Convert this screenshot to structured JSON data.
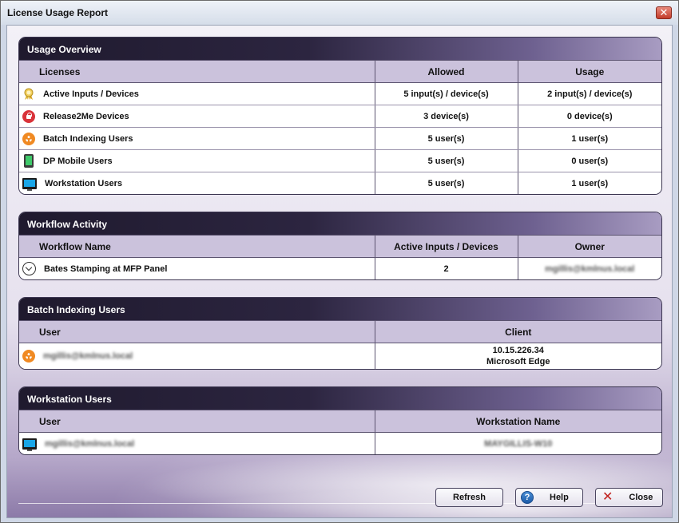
{
  "window": {
    "title": "License Usage Report",
    "close_glyph": "✕"
  },
  "usage_overview": {
    "title": "Usage Overview",
    "headers": [
      "Licenses",
      "Allowed",
      "Usage"
    ],
    "rows": [
      {
        "icon": "ribbon-icon",
        "name": "Active Inputs / Devices",
        "allowed": "5 input(s) / device(s)",
        "usage": "2 input(s) / device(s)"
      },
      {
        "icon": "lock-icon",
        "name": "Release2Me Devices",
        "allowed": "3 device(s)",
        "usage": "0 device(s)"
      },
      {
        "icon": "batch-indexing-icon",
        "name": "Batch Indexing Users",
        "allowed": "5 user(s)",
        "usage": "1 user(s)"
      },
      {
        "icon": "mobile-phone-icon",
        "name": "DP Mobile Users",
        "allowed": "5 user(s)",
        "usage": "0 user(s)"
      },
      {
        "icon": "monitor-icon",
        "name": "Workstation Users",
        "allowed": "5 user(s)",
        "usage": "1 user(s)"
      }
    ]
  },
  "workflow_activity": {
    "title": "Workflow Activity",
    "headers": [
      "Workflow Name",
      "Active Inputs / Devices",
      "Owner"
    ],
    "rows": [
      {
        "name": "Bates Stamping at MFP Panel",
        "active": "2",
        "owner": "mgillis@kmlnus.local"
      }
    ]
  },
  "batch_indexing_users": {
    "title": "Batch Indexing Users",
    "headers": [
      "User",
      "Client"
    ],
    "rows": [
      {
        "user": "mgillis@kmlnus.local",
        "client_ip": "10.15.226.34",
        "client_browser": "Microsoft Edge"
      }
    ]
  },
  "workstation_users": {
    "title": "Workstation Users",
    "headers": [
      "User",
      "Workstation Name"
    ],
    "rows": [
      {
        "user": "mgillis@kmlnus.local",
        "workstation": "MAYGILLIS-W10"
      }
    ]
  },
  "buttons": {
    "refresh": "Refresh",
    "help": "Help",
    "close": "Close",
    "help_glyph": "?",
    "close_glyph": "✕"
  },
  "colors": {
    "header_dark": "#1f1a2e",
    "column_header": "#cbc2dc",
    "accent_red": "#c0201c"
  }
}
